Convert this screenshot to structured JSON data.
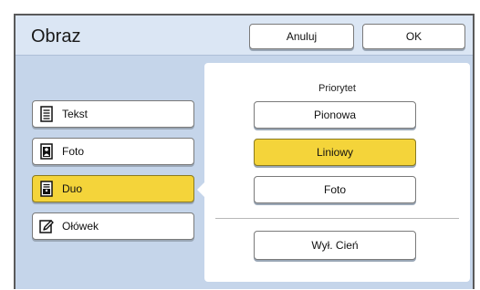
{
  "header": {
    "title": "Obraz",
    "cancel_label": "Anuluj",
    "ok_label": "OK"
  },
  "modes": [
    {
      "label": "Tekst",
      "icon": "text-document-icon",
      "selected": false
    },
    {
      "label": "Foto",
      "icon": "photo-document-icon",
      "selected": false
    },
    {
      "label": "Duo",
      "icon": "duo-document-icon",
      "selected": true
    },
    {
      "label": "Ołówek",
      "icon": "pencil-icon",
      "selected": false
    }
  ],
  "priority": {
    "label": "Priorytet",
    "options": [
      {
        "label": "Pionowa",
        "selected": false
      },
      {
        "label": "Liniowy",
        "selected": true
      },
      {
        "label": "Foto",
        "selected": false
      }
    ]
  },
  "shadow_button_label": "Wył. Cień",
  "colors": {
    "selected": "#f4d43a",
    "background": "#c5d5ea",
    "header": "#dbe6f4"
  }
}
